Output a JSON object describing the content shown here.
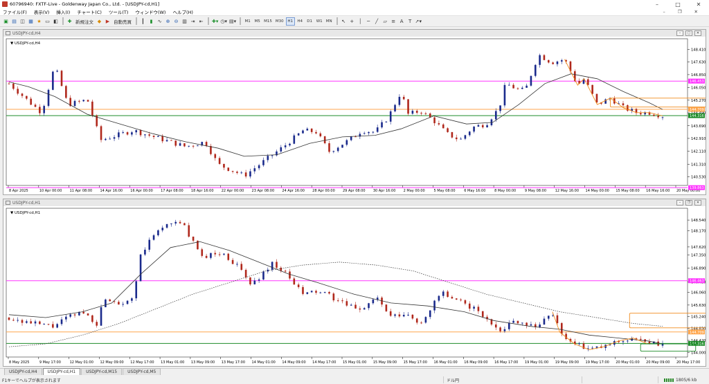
{
  "window": {
    "title": "60796940: FXTF-Live - Goldenway Japan Co., Ltd. - [USDJPY-cd,H1]",
    "minimize": "–",
    "maximize": "□",
    "close": "✕"
  },
  "menu": [
    "ファイル(F)",
    "表示(V)",
    "挿入(I)",
    "チャート(C)",
    "ツール(T)",
    "ウィンドウ(W)",
    "ヘルプ(H)"
  ],
  "toolbar": {
    "new_order": "新規注文",
    "auto_trading": "自動売買",
    "timeframes": [
      "M1",
      "M5",
      "M15",
      "M30",
      "H1",
      "H4",
      "D1",
      "W1",
      "MN"
    ],
    "active_timeframe": "H1"
  },
  "colors": {
    "bull": "#1a2a8c",
    "bear": "#b0281c",
    "ma": "#333333",
    "magenta": "#ff33ff",
    "orange": "#ffa64d",
    "green": "#1e8c2a",
    "annot": "#f08a1a"
  },
  "charts": [
    {
      "label": "USDJPY-cd,H4",
      "inner_label": "USDJPY-cd,H4",
      "ylim": [
        140.0,
        148.9
      ],
      "yticks": [
        "148.410",
        "147.630",
        "146.850",
        "146.050",
        "145.270",
        "144.490",
        "143.690",
        "142.910",
        "142.110",
        "141.310",
        "140.530"
      ],
      "xticks": [
        "8 Apr 2025",
        "10 Apr 00:00",
        "11 Apr 08:00",
        "14 Apr 16:00",
        "16 Apr 00:00",
        "17 Apr 08:00",
        "18 Apr 16:00",
        "22 Apr 00:00",
        "23 Apr 08:00",
        "24 Apr 16:00",
        "28 Apr 00:00",
        "29 Apr 08:00",
        "30 Apr 16:00",
        "2 May 00:00",
        "5 May 08:00",
        "6 May 16:00",
        "8 May 00:00",
        "9 May 08:00",
        "12 May 16:00",
        "14 May 00:00",
        "15 May 08:00",
        "16 May 16:00",
        "20 May 00:00"
      ],
      "levels": [
        {
          "label": "146.453",
          "value": 146.453,
          "color": "magenta"
        },
        {
          "label": "144.709",
          "value": 144.709,
          "color": "orange"
        },
        {
          "label": "144.316",
          "value": 144.316,
          "color": "green",
          "current": true
        },
        {
          "label": "139.863",
          "value": 139.863,
          "color": "magenta"
        }
      ],
      "path": [
        [
          0,
          146.3
        ],
        [
          6,
          145.2
        ],
        [
          10,
          144.5
        ],
        [
          14,
          147.4
        ],
        [
          18,
          145.0
        ],
        [
          24,
          145.3
        ],
        [
          28,
          142.8
        ],
        [
          38,
          143.4
        ],
        [
          46,
          142.9
        ],
        [
          54,
          142.4
        ],
        [
          60,
          142.7
        ],
        [
          64,
          141.3
        ],
        [
          72,
          140.6
        ],
        [
          78,
          141.5
        ],
        [
          84,
          142.4
        ],
        [
          90,
          143.4
        ],
        [
          94,
          143.3
        ],
        [
          98,
          142.1
        ],
        [
          104,
          142.8
        ],
        [
          108,
          143.4
        ],
        [
          112,
          143.3
        ],
        [
          116,
          144.2
        ],
        [
          120,
          145.8
        ],
        [
          122,
          144.4
        ],
        [
          126,
          144.6
        ],
        [
          130,
          144.0
        ],
        [
          134,
          143.2
        ],
        [
          138,
          142.8
        ],
        [
          142,
          143.6
        ],
        [
          146,
          143.8
        ],
        [
          150,
          144.8
        ],
        [
          152,
          146.3
        ],
        [
          156,
          145.9
        ],
        [
          158,
          145.9
        ],
        [
          162,
          148.1
        ],
        [
          166,
          147.6
        ],
        [
          170,
          147.8
        ],
        [
          174,
          146.2
        ],
        [
          176,
          146.6
        ],
        [
          180,
          145.0
        ],
        [
          184,
          145.4
        ],
        [
          188,
          144.8
        ],
        [
          192,
          144.5
        ],
        [
          196,
          144.5
        ],
        [
          200,
          144.3
        ]
      ],
      "ma_points": [
        [
          0,
          146.4
        ],
        [
          6,
          146.1
        ],
        [
          14,
          145.5
        ],
        [
          24,
          144.4
        ],
        [
          34,
          143.8
        ],
        [
          44,
          143.2
        ],
        [
          54,
          142.7
        ],
        [
          64,
          142.3
        ],
        [
          72,
          141.8
        ],
        [
          82,
          141.9
        ],
        [
          92,
          142.6
        ],
        [
          102,
          143.0
        ],
        [
          112,
          143.1
        ],
        [
          120,
          143.5
        ],
        [
          130,
          144.3
        ],
        [
          140,
          143.8
        ],
        [
          148,
          143.9
        ],
        [
          156,
          145.0
        ],
        [
          164,
          146.3
        ],
        [
          172,
          146.9
        ],
        [
          180,
          146.6
        ],
        [
          188,
          145.8
        ],
        [
          196,
          145.1
        ],
        [
          200,
          144.7
        ]
      ],
      "rects": [
        {
          "x": 184,
          "y0": 145.4,
          "y1": 144.85,
          "w": 14
        }
      ]
    },
    {
      "label": "USDJPY-cd,H1",
      "inner_label": "USDJPY-cd,H1",
      "ylim": [
        143.85,
        148.85
      ],
      "yticks": [
        "148.540",
        "148.170",
        "147.620",
        "147.350",
        "146.890",
        "146.420",
        "146.060",
        "145.630",
        "145.240",
        "144.830",
        "144.420",
        "144.000"
      ],
      "xticks": [
        "8 May 2025",
        "9 May 17:00",
        "12 May 01:00",
        "12 May 09:00",
        "12 May 17:00",
        "13 May 01:00",
        "13 May 09:00",
        "13 May 17:00",
        "14 May 01:00",
        "14 May 09:00",
        "14 May 17:00",
        "15 May 01:00",
        "15 May 09:00",
        "15 May 17:00",
        "16 May 01:00",
        "16 May 09:00",
        "16 May 17:00",
        "19 May 01:00",
        "19 May 09:00",
        "19 May 17:00",
        "20 May 01:00",
        "20 May 09:00",
        "20 May 17:00"
      ],
      "levels": [
        {
          "label": "146.463",
          "value": 146.463,
          "color": "magenta"
        },
        {
          "label": "144.709",
          "value": 144.709,
          "color": "orange"
        },
        {
          "label": "144.316",
          "value": 144.316,
          "color": "green",
          "current": true
        }
      ],
      "path": [
        [
          0,
          145.2
        ],
        [
          6,
          145.0
        ],
        [
          12,
          144.9
        ],
        [
          16,
          145.2
        ],
        [
          20,
          145.4
        ],
        [
          24,
          145.0
        ],
        [
          26,
          145.9
        ],
        [
          30,
          145.7
        ],
        [
          34,
          145.9
        ],
        [
          36,
          147.4
        ],
        [
          40,
          148.1
        ],
        [
          44,
          148.5
        ],
        [
          48,
          148.3
        ],
        [
          52,
          147.3
        ],
        [
          58,
          147.4
        ],
        [
          62,
          147.0
        ],
        [
          66,
          146.3
        ],
        [
          72,
          147.1
        ],
        [
          76,
          146.6
        ],
        [
          80,
          146.0
        ],
        [
          84,
          146.1
        ],
        [
          88,
          145.9
        ],
        [
          92,
          145.6
        ],
        [
          96,
          145.5
        ],
        [
          100,
          145.9
        ],
        [
          104,
          145.2
        ],
        [
          108,
          145.3
        ],
        [
          112,
          145.0
        ],
        [
          118,
          146.1
        ],
        [
          120,
          145.8
        ],
        [
          124,
          145.7
        ],
        [
          128,
          145.4
        ],
        [
          130,
          145.1
        ],
        [
          134,
          144.8
        ],
        [
          138,
          145.1
        ],
        [
          144,
          144.9
        ],
        [
          148,
          145.4
        ],
        [
          150,
          144.7
        ],
        [
          154,
          144.3
        ],
        [
          158,
          144.1
        ],
        [
          162,
          144.2
        ],
        [
          166,
          144.4
        ],
        [
          170,
          144.5
        ],
        [
          174,
          144.3
        ],
        [
          178,
          144.3
        ]
      ],
      "ma_points": [
        [
          0,
          145.3
        ],
        [
          10,
          145.2
        ],
        [
          20,
          145.4
        ],
        [
          28,
          145.7
        ],
        [
          36,
          146.7
        ],
        [
          44,
          147.6
        ],
        [
          52,
          147.8
        ],
        [
          60,
          147.5
        ],
        [
          68,
          147.1
        ],
        [
          76,
          146.7
        ],
        [
          84,
          146.4
        ],
        [
          94,
          146.0
        ],
        [
          104,
          145.7
        ],
        [
          114,
          145.6
        ],
        [
          124,
          145.4
        ],
        [
          132,
          145.1
        ],
        [
          142,
          144.9
        ],
        [
          150,
          144.8
        ],
        [
          158,
          144.6
        ],
        [
          166,
          144.5
        ],
        [
          174,
          144.4
        ],
        [
          178,
          144.3
        ]
      ],
      "ma2_points": [
        [
          0,
          144.2
        ],
        [
          10,
          144.3
        ],
        [
          20,
          144.6
        ],
        [
          30,
          145.0
        ],
        [
          40,
          145.5
        ],
        [
          50,
          146.0
        ],
        [
          60,
          146.4
        ],
        [
          70,
          146.8
        ],
        [
          80,
          147.0
        ],
        [
          90,
          147.1
        ],
        [
          100,
          147.0
        ],
        [
          110,
          146.8
        ],
        [
          120,
          146.4
        ],
        [
          130,
          146.0
        ],
        [
          140,
          145.7
        ],
        [
          150,
          145.4
        ],
        [
          160,
          145.2
        ],
        [
          170,
          145.0
        ],
        [
          178,
          144.9
        ]
      ],
      "rects": [
        {
          "x": 169,
          "y0": 145.35,
          "y1": 144.85,
          "w": 10
        },
        {
          "x": 172,
          "y0": 144.3,
          "y1": 144.05,
          "w": 6
        }
      ]
    }
  ],
  "tabs": [
    "USDJPY-cd,H4",
    "USDJPY-cd,H1",
    "USDJPY-cd,M15",
    "USDJPY-cd,M5"
  ],
  "active_tab": 1,
  "status": {
    "help": "F1キーでヘルプが表示されます",
    "profile": "ドル円",
    "traffic": "1805/6 kb"
  }
}
